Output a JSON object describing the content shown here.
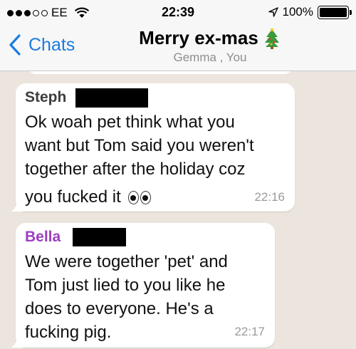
{
  "status_bar": {
    "carrier": "EE",
    "time": "22:39",
    "battery": "100%",
    "battery_level": 1.0
  },
  "nav": {
    "back_label": "Chats",
    "title": "Merry ex-mas",
    "title_icon": "christmas-tree-icon",
    "subtitle": "Gemma , You"
  },
  "messages": [
    {
      "sender": "Steph",
      "sender_color": "#3d3d3d",
      "lines": [
        "Ok woah pet think what you",
        "want but Tom said you weren't",
        "together after the holiday coz",
        "you fucked it"
      ],
      "emoji": "eyes-icon",
      "time": "22:16"
    },
    {
      "sender": "Bella",
      "sender_color": "#9b3fbf",
      "lines": [
        "We were together 'pet' and",
        "Tom just lied to you like he",
        "does to everyone. He's a",
        "fucking pig."
      ],
      "time": "22:17"
    }
  ],
  "colors": {
    "accent": "#1a7ce0",
    "chat_background": "#ece5dd",
    "bubble": "#ffffff"
  }
}
